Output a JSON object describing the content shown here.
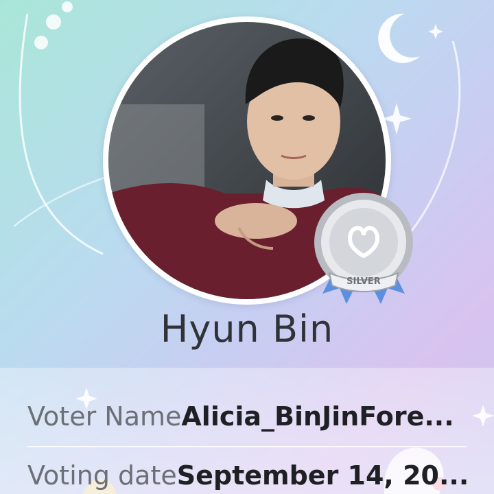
{
  "artist": {
    "name": "Hyun Bin"
  },
  "badge": {
    "label": "SILVER"
  },
  "info": {
    "voter_label": "Voter Name",
    "voter_value": "Alicia_BinJinFore...",
    "date_label": "Voting date",
    "date_value": "September 14, 20..."
  },
  "colors": {
    "background_start": "#a9e6d8",
    "background_end": "#d8c3ef",
    "ribbon": "#5b8fe0",
    "badge_silver": "#c7cbd0"
  },
  "icons": [
    "moon-icon",
    "sparkle-icon",
    "silver-medal-icon"
  ]
}
